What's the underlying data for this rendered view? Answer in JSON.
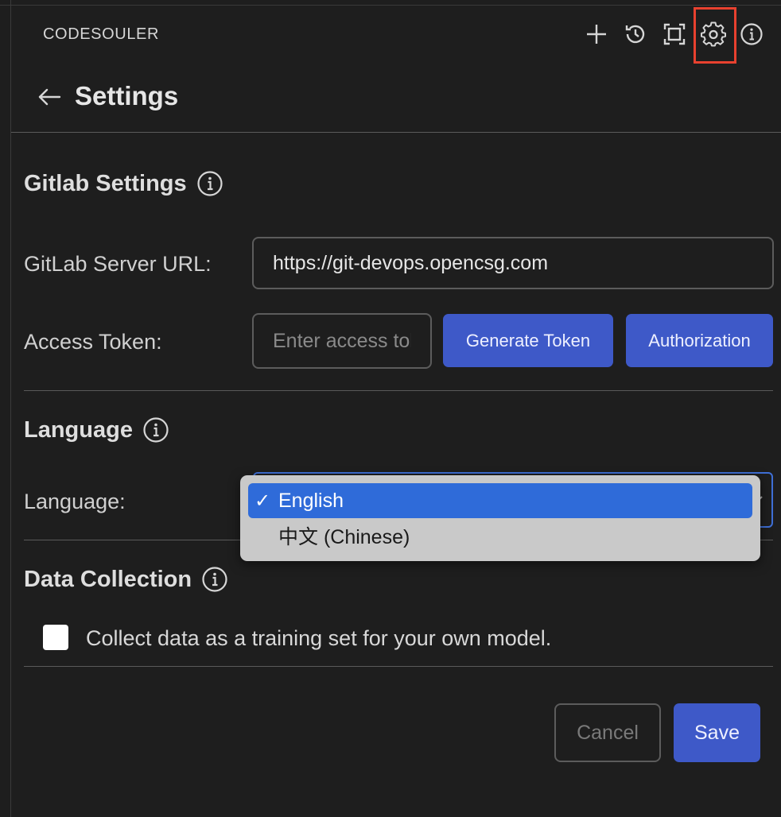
{
  "header": {
    "app_title": "CODESOULER",
    "icons": [
      "plus-icon",
      "history-icon",
      "maximize-icon",
      "gear-icon",
      "info-icon"
    ]
  },
  "page": {
    "title": "Settings"
  },
  "gitlab": {
    "section_title": "Gitlab Settings",
    "server_url_label": "GitLab Server URL:",
    "server_url_value": "https://git-devops.opencsg.com",
    "access_token_label": "Access Token:",
    "access_token_placeholder": "Enter access token",
    "generate_token_label": "Generate Token",
    "authorization_label": "Authorization"
  },
  "language": {
    "section_title": "Language",
    "field_label": "Language:",
    "options": [
      {
        "label": "English",
        "selected": true
      },
      {
        "label": "中文 (Chinese)",
        "selected": false
      }
    ]
  },
  "data_collection": {
    "section_title": "Data Collection",
    "checkbox_label": "Collect data as a training set for your own model."
  },
  "actions": {
    "cancel_label": "Cancel",
    "save_label": "Save"
  },
  "colors": {
    "background": "#1e1e1e",
    "primary_button": "#3e59c8",
    "highlight": "#e8412f",
    "dropdown_selected": "#2f6bd9"
  }
}
